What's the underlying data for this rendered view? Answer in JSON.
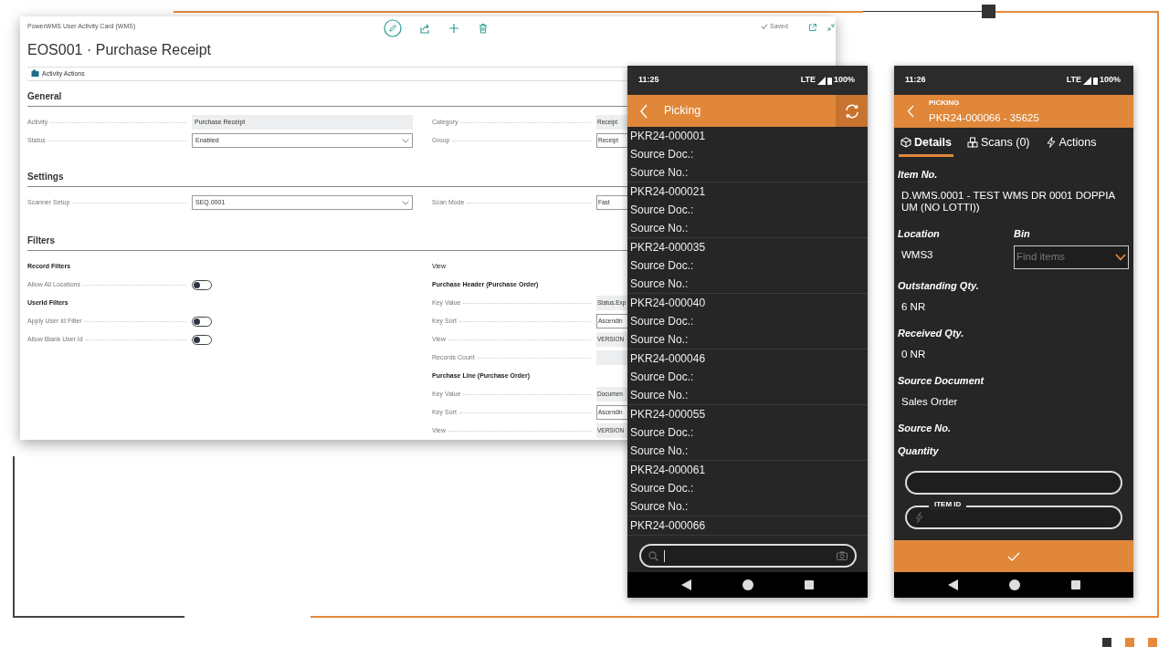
{
  "card": {
    "breadcrumb": "PowerWMS User Activity Card (WMS)",
    "title": "EOS001 · Purchase Receipt",
    "saved": "Saved",
    "action": "Activity Actions",
    "sections": [
      {
        "title": "General",
        "left": [
          {
            "kind": "readonly",
            "label": "Activity",
            "value": "Purchase Receipt"
          },
          {
            "kind": "dropdown",
            "label": "Status",
            "value": "Enabled"
          }
        ],
        "right": [
          {
            "kind": "readonly",
            "label": "Category",
            "value": "Receipt"
          },
          {
            "kind": "input",
            "label": "Group",
            "value": "Receipt"
          }
        ]
      },
      {
        "title": "Settings",
        "left": [
          {
            "kind": "dropdown",
            "label": "Scanner Setup",
            "value": "SEQ.0001"
          }
        ],
        "right": [
          {
            "kind": "input",
            "label": "Scan Mode",
            "value": "Fast"
          }
        ]
      },
      {
        "title": "Filters",
        "left": [
          {
            "kind": "heading",
            "label": "Record Filters"
          },
          {
            "kind": "toggle",
            "label": "Allow All Locations",
            "on": false
          },
          {
            "kind": "heading",
            "label": "UserId Filters"
          },
          {
            "kind": "toggle",
            "label": "Apply User Id Filter",
            "on": false
          },
          {
            "kind": "toggle",
            "label": "Allow Blank User Id",
            "on": false
          }
        ],
        "right": [
          {
            "kind": "subheading",
            "label": "View"
          },
          {
            "kind": "heading",
            "label": "Purchase Header (Purchase Order)"
          },
          {
            "kind": "readonly",
            "label": "Key Value",
            "value": "Status.Exp"
          },
          {
            "kind": "input",
            "label": "Key Sort",
            "value": "Ascendin"
          },
          {
            "kind": "readonly",
            "label": "View",
            "value": "VERSION"
          },
          {
            "kind": "readonly",
            "label": "Records Count"
          },
          {
            "kind": "heading",
            "label": "Purchase Line (Purchase Order)"
          },
          {
            "kind": "readonly",
            "label": "Key Value",
            "value": "Documen"
          },
          {
            "kind": "input",
            "label": "Key Sort",
            "value": "Ascendin"
          },
          {
            "kind": "readonly",
            "label": "View",
            "value": "VERSION"
          }
        ]
      }
    ]
  },
  "list_phone": {
    "status": {
      "time": "11:25",
      "network": "LTE",
      "battery": "100%"
    },
    "title": "Picking",
    "items": [
      {
        "id": "PKR24-000001",
        "fields": [
          "Source Doc.:",
          "Source No.:"
        ]
      },
      {
        "id": "PKR24-000021",
        "fields": [
          "Source Doc.:",
          "Source No.:"
        ]
      },
      {
        "id": "PKR24-000035",
        "fields": [
          "Source Doc.:",
          "Source No.:"
        ]
      },
      {
        "id": "PKR24-000040",
        "fields": [
          "Source Doc.:",
          "Source No.:"
        ]
      },
      {
        "id": "PKR24-000046",
        "fields": [
          "Source Doc.:",
          "Source No.:"
        ]
      },
      {
        "id": "PKR24-000055",
        "fields": [
          "Source Doc.:",
          "Source No.:"
        ]
      },
      {
        "id": "PKR24-000061",
        "fields": [
          "Source Doc.:",
          "Source No.:"
        ]
      },
      {
        "id": "PKR24-000066"
      }
    ]
  },
  "detail_phone": {
    "status": {
      "time": "11:26",
      "network": "LTE",
      "battery": "100%"
    },
    "subtitle": "PICKING",
    "title": "PKR24-000066 - 35625",
    "tabs": [
      {
        "kind": "box",
        "label": "Details",
        "selected": true
      },
      {
        "kind": "cubes",
        "label": "Scans (0)",
        "selected": false
      },
      {
        "kind": "bolt",
        "label": "Actions",
        "selected": false
      }
    ],
    "rows": [
      [
        {
          "kind": "text",
          "label": "Item No.",
          "value": "D.WMS.0001 - TEST WMS DR 0001 DOPPIA UM (NO LOTTI))"
        }
      ],
      [
        {
          "kind": "text",
          "label": "Location",
          "value": "WMS3"
        },
        {
          "kind": "dropdown",
          "label": "Bin",
          "placeholder": "Find items"
        }
      ],
      [
        {
          "kind": "text",
          "label": "Outstanding Qty.",
          "value": "6 NR"
        }
      ],
      [
        {
          "kind": "text",
          "label": "Received Qty.",
          "value": "0 NR"
        }
      ],
      [
        {
          "kind": "text",
          "label": "Source Document",
          "value": "Sales Order"
        }
      ],
      [
        {
          "kind": "text",
          "label": "Source No."
        }
      ],
      [
        {
          "kind": "text",
          "label": "Quantity"
        }
      ]
    ],
    "inputs": [
      {
        "kind": "plain"
      },
      {
        "kind": "scan",
        "label": "ITEM ID"
      }
    ]
  }
}
